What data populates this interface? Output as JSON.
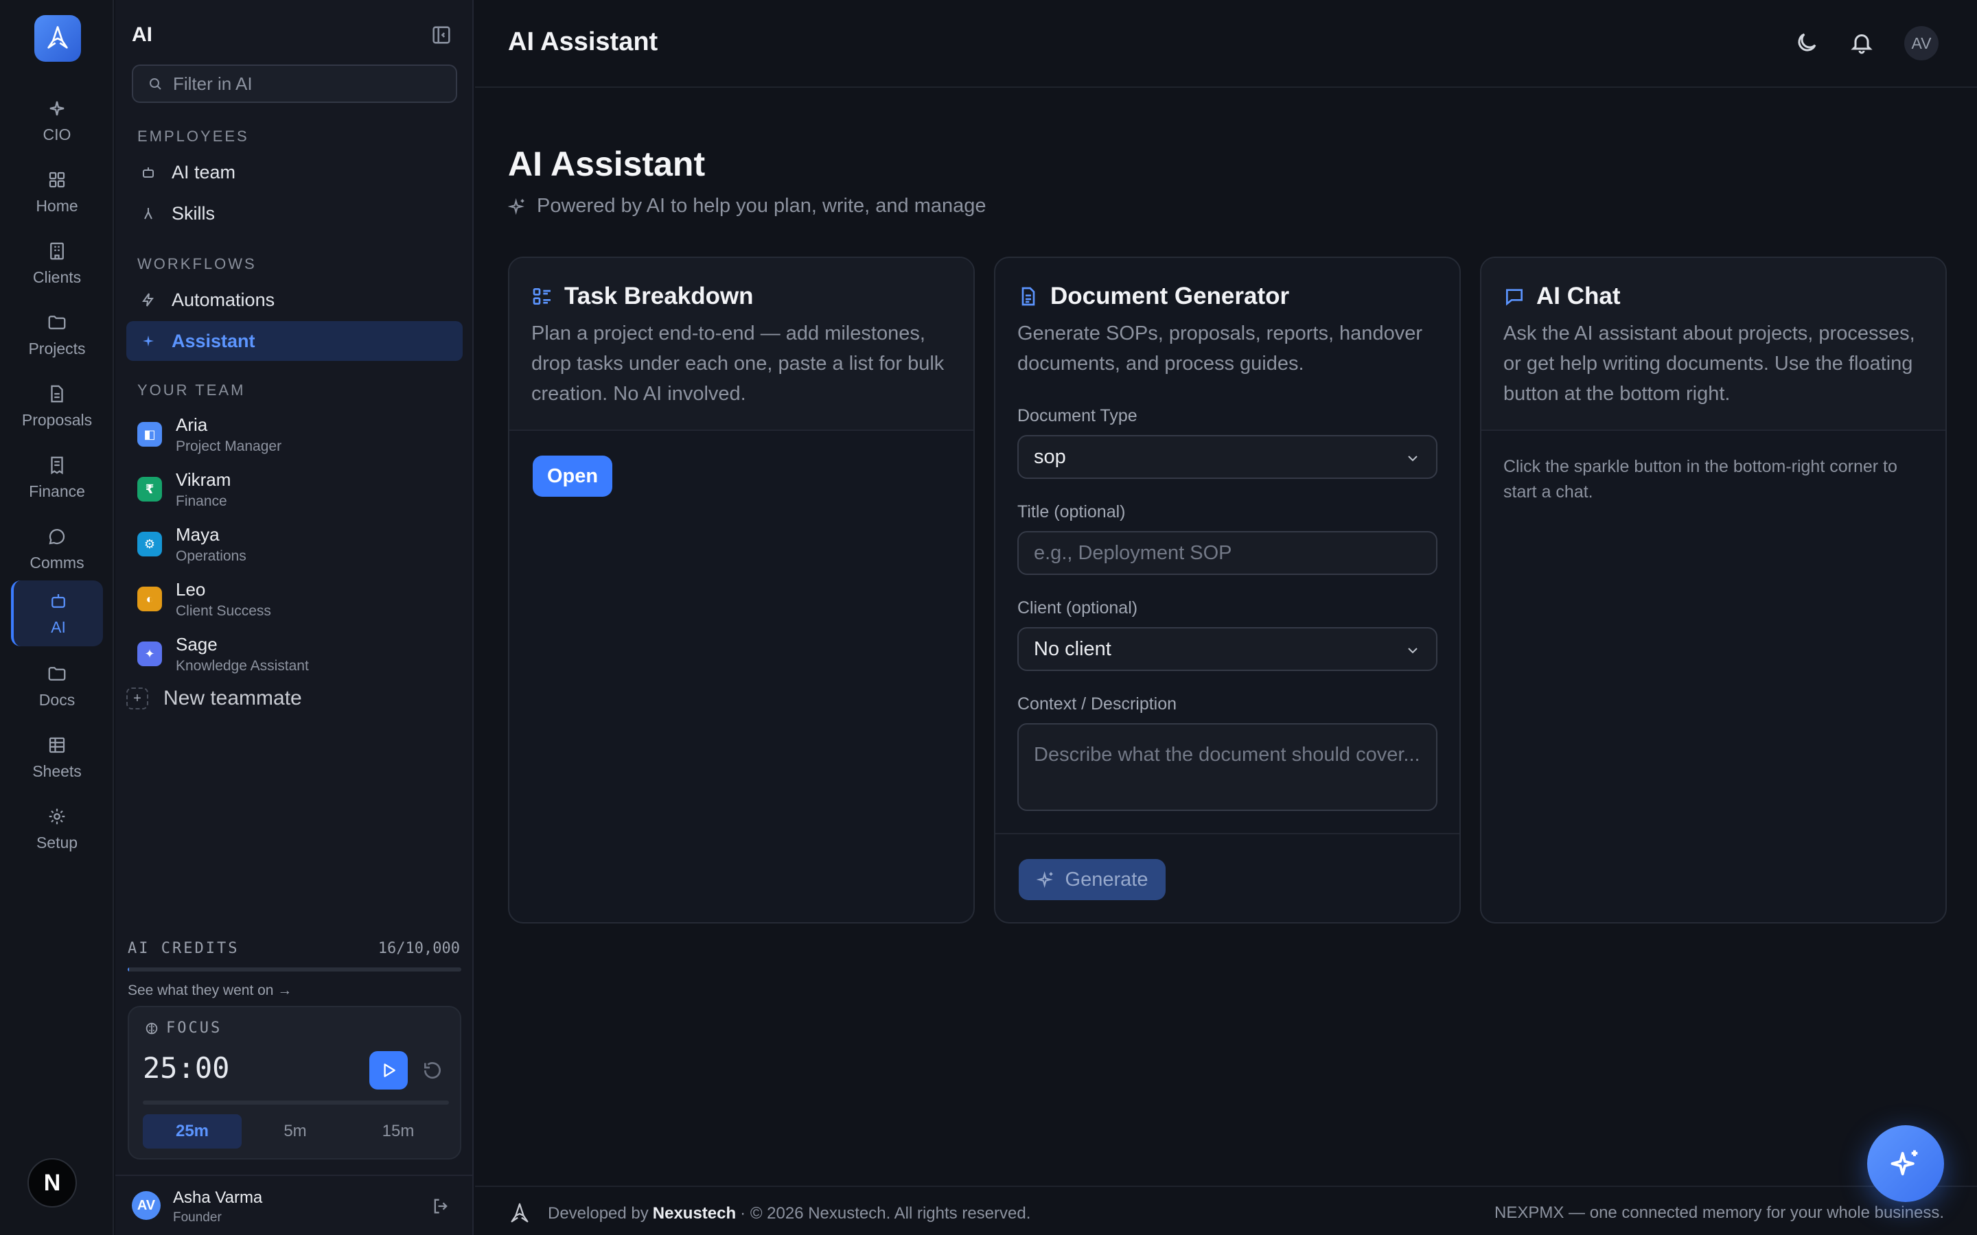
{
  "rail": {
    "items": [
      {
        "label": "CIO",
        "icon": "sparkle-icon"
      },
      {
        "label": "Home",
        "icon": "grid-icon"
      },
      {
        "label": "Clients",
        "icon": "building-icon"
      },
      {
        "label": "Projects",
        "icon": "folder-icon"
      },
      {
        "label": "Proposals",
        "icon": "document-icon"
      },
      {
        "label": "Finance",
        "icon": "receipt-icon"
      },
      {
        "label": "Comms",
        "icon": "message-icon"
      },
      {
        "label": "AI",
        "icon": "robot-icon"
      },
      {
        "label": "Docs",
        "icon": "folder-icon"
      },
      {
        "label": "Sheets",
        "icon": "table-icon"
      },
      {
        "label": "Setup",
        "icon": "gear-icon"
      }
    ],
    "active": "AI",
    "badge": "N"
  },
  "panel": {
    "title": "AI",
    "filter_placeholder": "Filter in AI",
    "sections": {
      "employees": "EMPLOYEES",
      "workflows": "WORKFLOWS",
      "team": "YOUR TEAM"
    },
    "employees": [
      {
        "label": "AI team"
      },
      {
        "label": "Skills"
      }
    ],
    "workflows": [
      {
        "label": "Automations"
      },
      {
        "label": "Assistant"
      }
    ],
    "team": [
      {
        "name": "Aria",
        "role": "Project Manager",
        "color": "#4f8cf7",
        "glyph": "◧"
      },
      {
        "name": "Vikram",
        "role": "Finance",
        "color": "#16a36b",
        "glyph": "₹"
      },
      {
        "name": "Maya",
        "role": "Operations",
        "color": "#1596d6",
        "glyph": "⚙"
      },
      {
        "name": "Leo",
        "role": "Client Success",
        "color": "#e39a16",
        "glyph": "◐"
      },
      {
        "name": "Sage",
        "role": "Knowledge Assistant",
        "color": "#5b73ef",
        "glyph": "✦"
      }
    ],
    "new_teammate": "New teammate",
    "credits": {
      "label": "AI CREDITS",
      "value": "16/10,000",
      "used": 16,
      "total": 10000,
      "link": "See what they went on →"
    },
    "focus": {
      "label": "FOCUS",
      "time": "25:00",
      "presets": [
        "25m",
        "5m",
        "15m"
      ],
      "active_preset": "25m"
    },
    "user": {
      "initials": "AV",
      "name": "Asha Varma",
      "role": "Founder"
    }
  },
  "topbar": {
    "title": "AI Assistant",
    "avatar": "AV"
  },
  "page": {
    "title": "AI Assistant",
    "subtitle": "Powered by AI to help you plan, write, and manage"
  },
  "cards": {
    "task": {
      "title": "Task Breakdown",
      "description": "Plan a project end-to-end — add milestones, drop tasks under each one, paste a list for bulk creation. No AI involved.",
      "button": "Open"
    },
    "doc": {
      "title": "Document Generator",
      "description": "Generate SOPs, proposals, reports, handover documents, and process guides.",
      "type_label": "Document Type",
      "type_value": "sop",
      "title_label": "Title (optional)",
      "title_placeholder": "e.g., Deployment SOP",
      "client_label": "Client (optional)",
      "client_value": "No client",
      "context_label": "Context / Description",
      "context_placeholder": "Describe what the document should cover...",
      "button": "Generate"
    },
    "chat": {
      "title": "AI Chat",
      "description": "Ask the AI assistant about projects, processes, or get help writing documents. Use the floating button at the bottom right.",
      "hint": "Click the sparkle button in the bottom-right corner to start a chat."
    }
  },
  "footer": {
    "prefix": "Developed by",
    "brand": "Nexustech",
    "suffix": "· © 2026 Nexustech. All rights reserved.",
    "right": "NEXPMX — one connected memory for your whole business."
  },
  "colors": {
    "accent": "#3b7cff",
    "background": "#10131a"
  }
}
